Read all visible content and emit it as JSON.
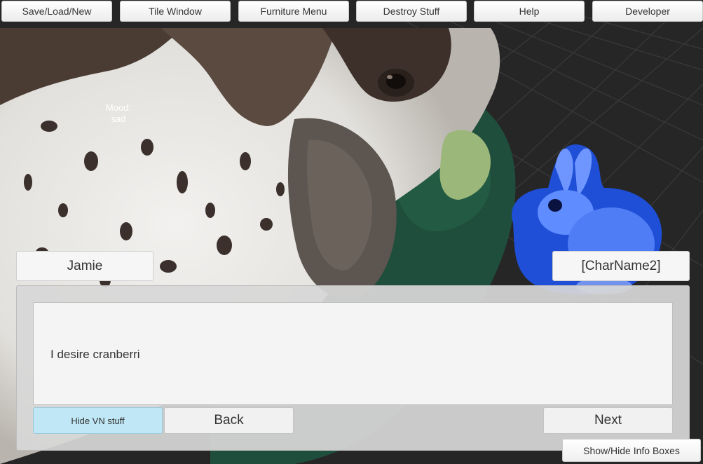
{
  "menu": {
    "items": [
      {
        "label": "Save/Load/New"
      },
      {
        "label": "Tile Window"
      },
      {
        "label": "Furniture Menu"
      },
      {
        "label": "Destroy Stuff"
      },
      {
        "label": "Help"
      },
      {
        "label": "Developer"
      }
    ]
  },
  "character": {
    "mood_label": "Mood:",
    "mood_value": "sad"
  },
  "names": {
    "left": "Jamie",
    "right": "[CharName2]"
  },
  "dialogue": {
    "text": "I desire cranberri"
  },
  "controls": {
    "hide_vn": "Hide VN stuff",
    "back": "Back",
    "next": "Next",
    "show_hide_info": "Show/Hide Info Boxes"
  },
  "colors": {
    "hide_vn_bg": "#bfe7f5",
    "scene_bg": "#2a2a2a",
    "sprite_tint": "#3a6cf0"
  }
}
